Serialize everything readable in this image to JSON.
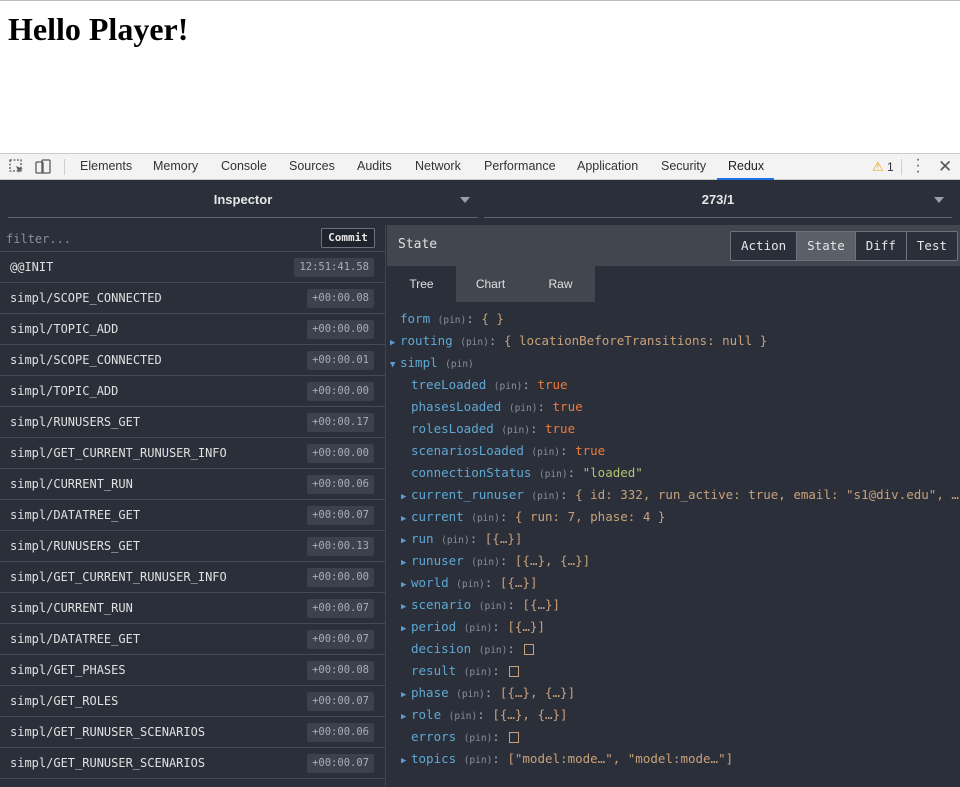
{
  "page": {
    "heading": "Hello Player!"
  },
  "devtools": {
    "tabs": [
      "Elements",
      "Memory",
      "Console",
      "Sources",
      "Audits",
      "Network",
      "Performance",
      "Application",
      "Security",
      "Redux"
    ],
    "active_tab": "Redux",
    "warning_count": "1"
  },
  "redux": {
    "instance_selector": "Inspector",
    "monitor_selector": "273/1",
    "filter_placeholder": "filter...",
    "commit_label": "Commit",
    "actions": [
      {
        "name": "@@INIT",
        "time": "12:51:41.58"
      },
      {
        "name": "simpl/SCOPE_CONNECTED",
        "time": "+00:00.08"
      },
      {
        "name": "simpl/TOPIC_ADD",
        "time": "+00:00.00"
      },
      {
        "name": "simpl/SCOPE_CONNECTED",
        "time": "+00:00.01"
      },
      {
        "name": "simpl/TOPIC_ADD",
        "time": "+00:00.00"
      },
      {
        "name": "simpl/RUNUSERS_GET",
        "time": "+00:00.17"
      },
      {
        "name": "simpl/GET_CURRENT_RUNUSER_INFO",
        "time": "+00:00.00"
      },
      {
        "name": "simpl/CURRENT_RUN",
        "time": "+00:00.06"
      },
      {
        "name": "simpl/DATATREE_GET",
        "time": "+00:00.07"
      },
      {
        "name": "simpl/RUNUSERS_GET",
        "time": "+00:00.13"
      },
      {
        "name": "simpl/GET_CURRENT_RUNUSER_INFO",
        "time": "+00:00.00"
      },
      {
        "name": "simpl/CURRENT_RUN",
        "time": "+00:00.07"
      },
      {
        "name": "simpl/DATATREE_GET",
        "time": "+00:00.07"
      },
      {
        "name": "simpl/GET_PHASES",
        "time": "+00:00.08"
      },
      {
        "name": "simpl/GET_ROLES",
        "time": "+00:00.07"
      },
      {
        "name": "simpl/GET_RUNUSER_SCENARIOS",
        "time": "+00:00.06"
      },
      {
        "name": "simpl/GET_RUNUSER_SCENARIOS",
        "time": "+00:00.07"
      }
    ],
    "state_title": "State",
    "modes": [
      "Action",
      "State",
      "Diff",
      "Test"
    ],
    "active_mode": "State",
    "subtabs": [
      "Tree",
      "Chart",
      "Raw"
    ],
    "active_subtab": "Tree",
    "pin_label": "(pin)",
    "tree": [
      {
        "key": "form",
        "indent": 0,
        "arrow": "",
        "value": "{ }",
        "type": "obj"
      },
      {
        "key": "routing",
        "indent": 0,
        "arrow": "right",
        "value": "{ locationBeforeTransitions: null }",
        "type": "obj"
      },
      {
        "key": "simpl",
        "indent": 0,
        "arrow": "down",
        "value": "",
        "type": "none"
      },
      {
        "key": "treeLoaded",
        "indent": 1,
        "arrow": "",
        "value": "true",
        "type": "bool"
      },
      {
        "key": "phasesLoaded",
        "indent": 1,
        "arrow": "",
        "value": "true",
        "type": "bool"
      },
      {
        "key": "rolesLoaded",
        "indent": 1,
        "arrow": "",
        "value": "true",
        "type": "bool"
      },
      {
        "key": "scenariosLoaded",
        "indent": 1,
        "arrow": "",
        "value": "true",
        "type": "bool"
      },
      {
        "key": "connectionStatus",
        "indent": 1,
        "arrow": "",
        "value": "\"loaded\"",
        "type": "str"
      },
      {
        "key": "current_runuser",
        "indent": 1,
        "arrow": "right",
        "value": "{ id: 332, run_active: true, email: \"s1@div.edu\", … }",
        "type": "obj"
      },
      {
        "key": "current",
        "indent": 1,
        "arrow": "right",
        "value": "{ run: 7, phase: 4 }",
        "type": "obj"
      },
      {
        "key": "run",
        "indent": 1,
        "arrow": "right",
        "value": "[{…}]",
        "type": "obj"
      },
      {
        "key": "runuser",
        "indent": 1,
        "arrow": "right",
        "value": "[{…}, {…}]",
        "type": "obj"
      },
      {
        "key": "world",
        "indent": 1,
        "arrow": "right",
        "value": "[{…}]",
        "type": "obj"
      },
      {
        "key": "scenario",
        "indent": 1,
        "arrow": "right",
        "value": "[{…}]",
        "type": "obj"
      },
      {
        "key": "period",
        "indent": 1,
        "arrow": "right",
        "value": "[{…}]",
        "type": "obj"
      },
      {
        "key": "decision",
        "indent": 1,
        "arrow": "",
        "value": "",
        "type": "empty"
      },
      {
        "key": "result",
        "indent": 1,
        "arrow": "",
        "value": "",
        "type": "empty"
      },
      {
        "key": "phase",
        "indent": 1,
        "arrow": "right",
        "value": "[{…}, {…}]",
        "type": "obj"
      },
      {
        "key": "role",
        "indent": 1,
        "arrow": "right",
        "value": "[{…}, {…}]",
        "type": "obj"
      },
      {
        "key": "errors",
        "indent": 1,
        "arrow": "",
        "value": "",
        "type": "empty"
      },
      {
        "key": "topics",
        "indent": 1,
        "arrow": "right",
        "value": "[\"model:mode…\", \"model:mode…\"]",
        "type": "obj"
      }
    ]
  }
}
